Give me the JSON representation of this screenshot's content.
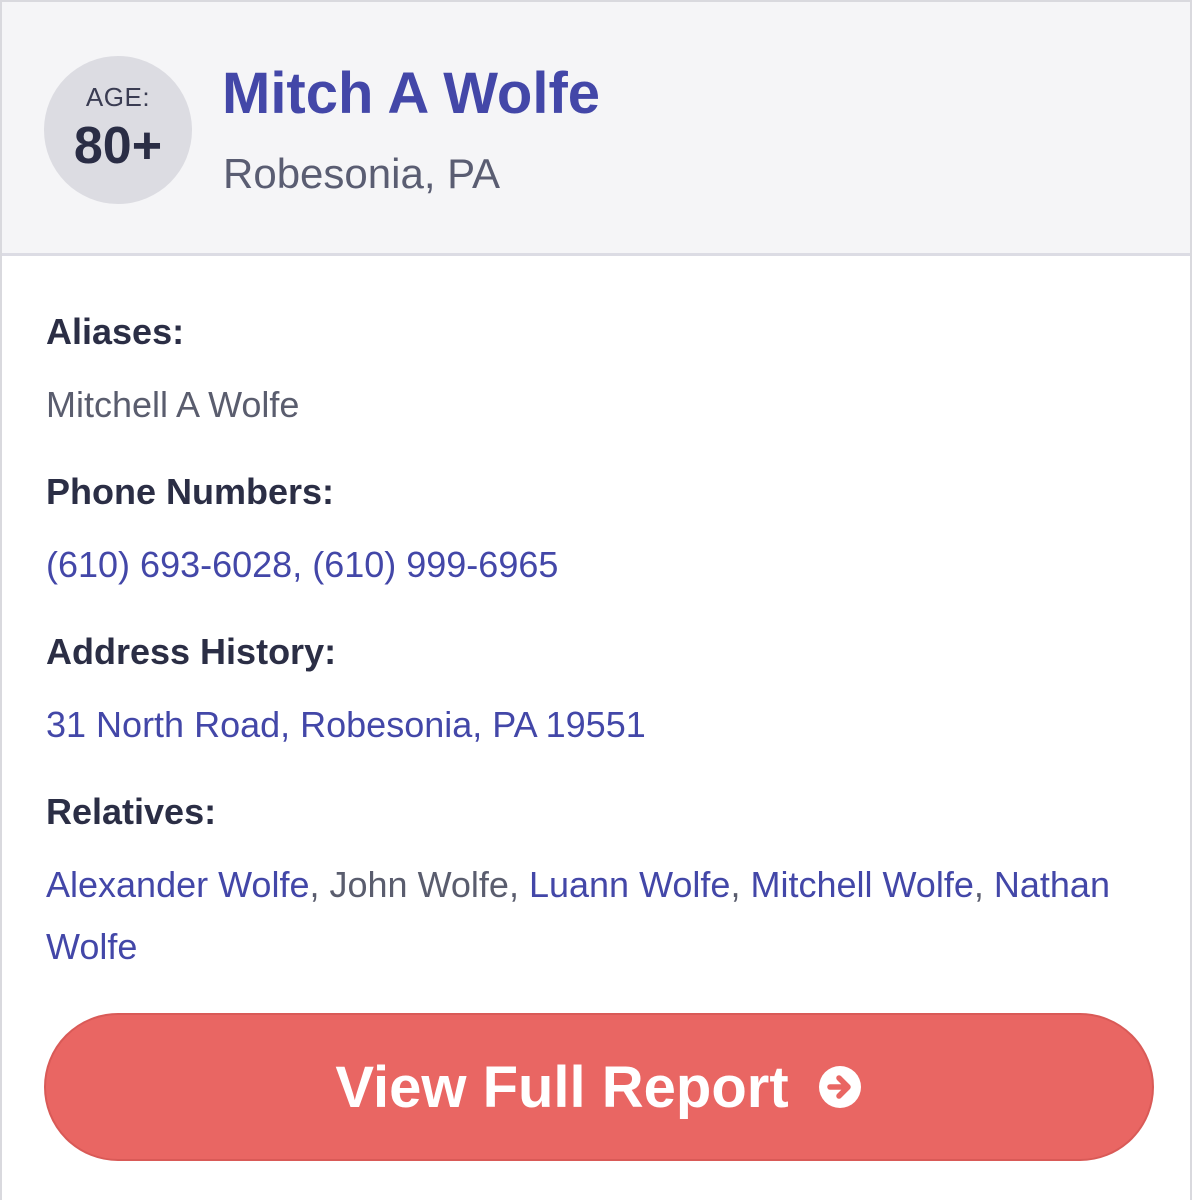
{
  "profile": {
    "age_label": "AGE:",
    "age_value": "80+",
    "name": "Mitch A Wolfe",
    "location": "Robesonia, PA"
  },
  "aliases": {
    "title": "Aliases:",
    "value": "Mitchell A Wolfe"
  },
  "phones": {
    "title": "Phone Numbers:",
    "items": [
      "(610) 693-6028",
      "(610) 999-6965"
    ],
    "separator": ", "
  },
  "address": {
    "title": "Address History:",
    "value": "31 North Road, Robesonia, PA 19551"
  },
  "relatives": {
    "title": "Relatives:",
    "items": [
      {
        "name": "Alexander Wolfe",
        "linked": true
      },
      {
        "name": "John Wolfe",
        "linked": false
      },
      {
        "name": "Luann Wolfe",
        "linked": true
      },
      {
        "name": "Mitchell Wolfe",
        "linked": true
      },
      {
        "name": "Nathan Wolfe",
        "linked": true
      }
    ],
    "separator": ", "
  },
  "cta": {
    "label": "View Full Report",
    "icon": "arrow-right-circle-icon"
  },
  "colors": {
    "accent": "#4347a8",
    "cta_background": "#e96663",
    "header_background": "#f5f5f7",
    "age_badge": "#dcdce2"
  }
}
